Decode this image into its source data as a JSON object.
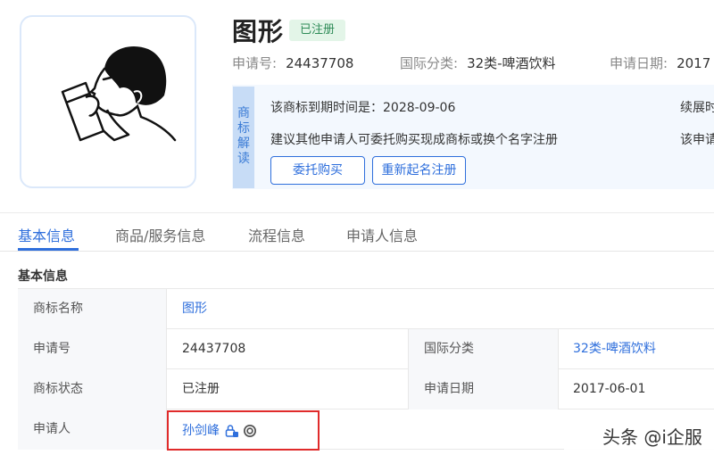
{
  "trademark": {
    "title": "图形",
    "status_badge": "已注册",
    "logo_icon": "person-drinking-icon"
  },
  "meta": {
    "app_no_label": "申请号:",
    "app_no": "24437708",
    "class_label": "国际分类:",
    "class_value": "32类-啤酒饮料",
    "date_label": "申请日期:",
    "date_value": "2017"
  },
  "interpret": {
    "tab_chars": [
      "商",
      "标",
      "解",
      "读"
    ],
    "expiry_text": "该商标到期时间是：2028-09-06",
    "suggest_text": "建议其他申请人可委托购买现成商标或换个名字注册",
    "right_text_1": "续展时",
    "right_text_2": "该申请",
    "btn_entrust": "委托购买",
    "btn_rename": "重新起名注册"
  },
  "tabs": [
    "基本信息",
    "商品/服务信息",
    "流程信息",
    "申请人信息"
  ],
  "section_title": "基本信息",
  "table": {
    "name_label": "商标名称",
    "name_value": "图形",
    "app_no_label": "申请号",
    "app_no_value": "24437708",
    "class_label": "国际分类",
    "class_value": "32类-啤酒饮料",
    "status_label": "商标状态",
    "status_value": "已注册",
    "date_label": "申请日期",
    "date_value": "2017-06-01",
    "applicant_label": "申请人",
    "applicant_value": "孙剑峰"
  },
  "watermark": "头条 @i企服",
  "colors": {
    "accent": "#2f6fdc",
    "status_green": "#2e8b57",
    "highlight_red": "#e02b2b"
  }
}
